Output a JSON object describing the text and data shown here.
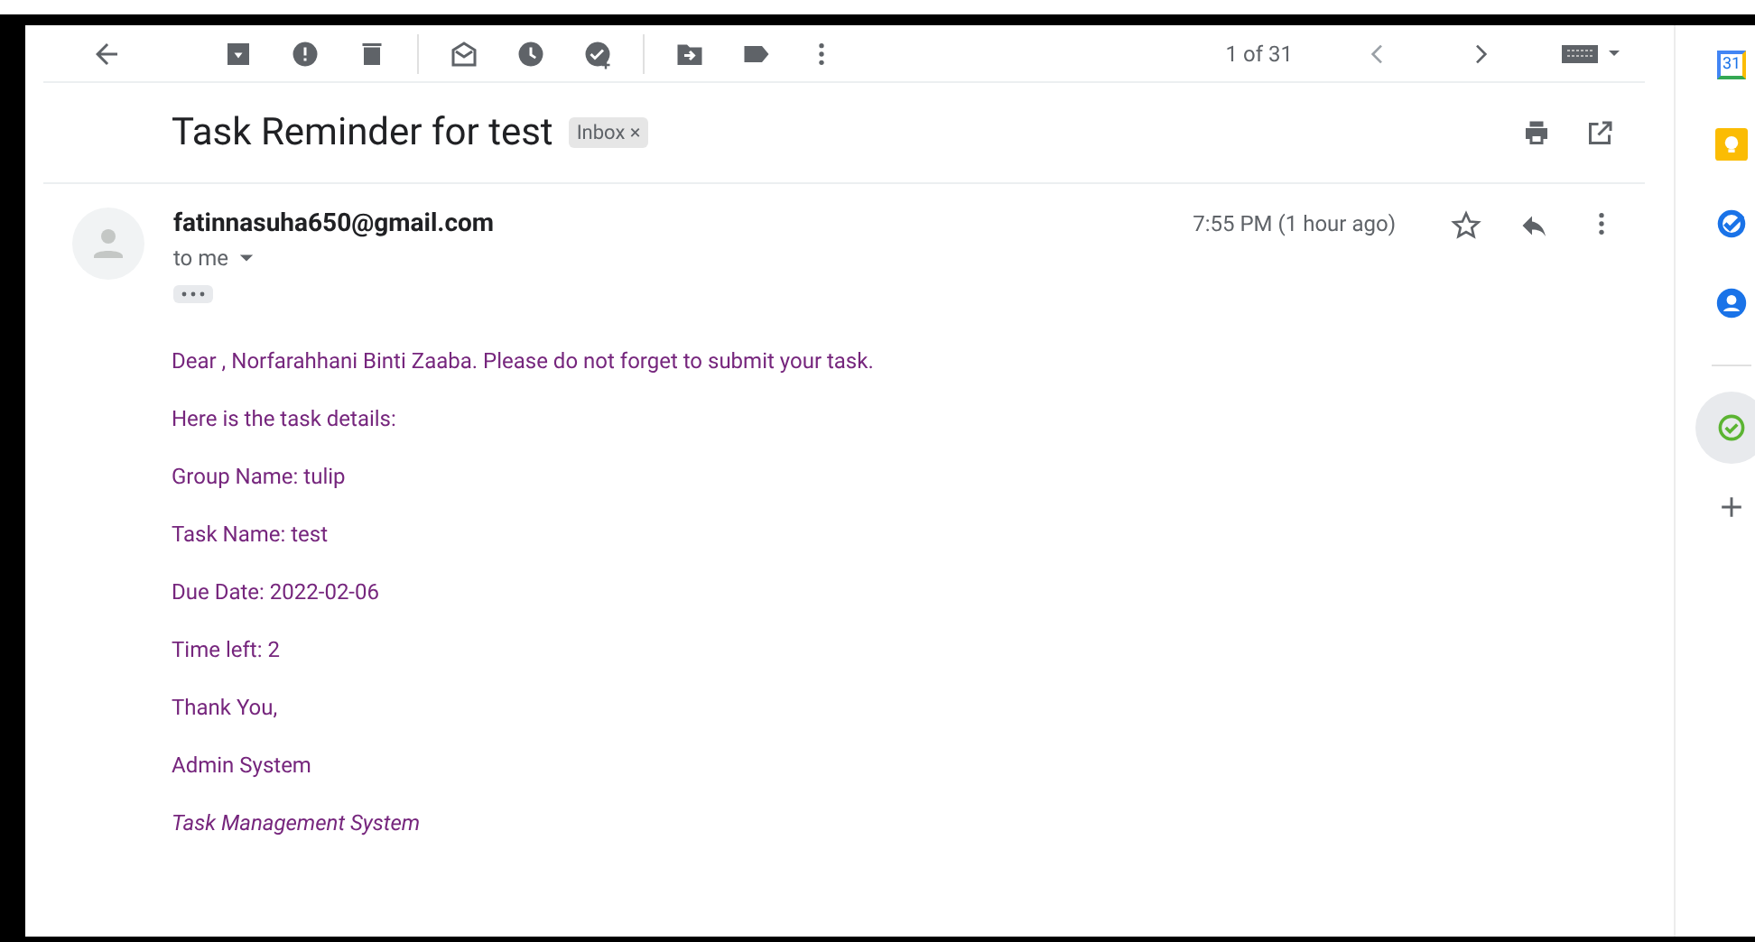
{
  "toolbar": {
    "pager": "1 of 31"
  },
  "message": {
    "subject": "Task Reminder for test",
    "label": {
      "text": "Inbox",
      "close": "×"
    },
    "sender": "fatinnasuha650@gmail.com",
    "recipient": "to me",
    "time": "7:55 PM (1 hour ago)",
    "body": [
      {
        "kind": "plain",
        "text": "Dear , Norfarahhani Binti Zaaba. Please do not forget to submit your task."
      },
      {
        "kind": "plain",
        "text": "Here is the task details:"
      },
      {
        "kind": "plain",
        "text": "Group Name: tulip"
      },
      {
        "kind": "plain",
        "text": "Task Name: test"
      },
      {
        "kind": "plain",
        "text": "Due Date: 2022-02-06"
      },
      {
        "kind": "plain",
        "text": "Time left: 2"
      },
      {
        "kind": "plain",
        "text": "Thank You,"
      },
      {
        "kind": "plain",
        "text": "Admin System"
      },
      {
        "kind": "signature",
        "text": "Task Management System"
      }
    ]
  },
  "side_panel": {
    "apps": [
      {
        "kind": "calendar",
        "label": "31",
        "selected": false
      },
      {
        "kind": "keep",
        "selected": false
      },
      {
        "kind": "tasks",
        "selected": false
      },
      {
        "kind": "contacts",
        "selected": false
      },
      {
        "kind": "divider"
      },
      {
        "kind": "addon",
        "selected": true
      },
      {
        "kind": "add",
        "selected": false
      }
    ]
  }
}
